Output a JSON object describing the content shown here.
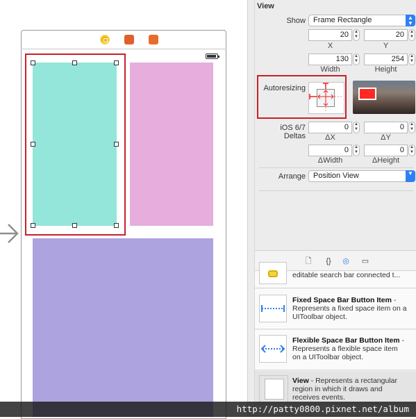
{
  "canvas": {
    "dock_icons": [
      "view-controller-icon",
      "first-responder-icon",
      "exit-icon"
    ],
    "colors": {
      "green_view": "#93e6d9",
      "pink_view": "#e6addd",
      "purple_view": "#ada3df",
      "selection": "#c8202a"
    }
  },
  "inspector": {
    "section_title": "View",
    "show_label": "Show",
    "show_value": "Frame Rectangle",
    "frame": {
      "x": "20",
      "y": "20",
      "width": "130",
      "height": "254",
      "x_label": "X",
      "y_label": "Y",
      "width_label": "Width",
      "height_label": "Height"
    },
    "autoresizing_label": "Autoresizing",
    "deltas_label": "iOS 6/7 Deltas",
    "deltas": {
      "dx": "0",
      "dy": "0",
      "dwidth": "0",
      "dheight": "0",
      "dx_label": "ΔX",
      "dy_label": "ΔY",
      "dwidth_label": "ΔWidth",
      "dheight_label": "ΔHeight"
    },
    "arrange_label": "Arrange",
    "arrange_value": "Position View"
  },
  "library": {
    "tabs": [
      "file-template-icon",
      "code-snippet-icon",
      "object-library-icon",
      "media-library-icon"
    ],
    "tab_glyphs": [
      "🗋",
      "{}",
      "◎",
      "▭"
    ],
    "items": [
      {
        "title": "",
        "desc": "editable search bar connected t..."
      },
      {
        "title": "Fixed Space Bar Button Item",
        "desc": " - Represents a fixed space item on a UIToolbar object."
      },
      {
        "title": "Flexible Space Bar Button Item",
        "desc": " - Represents a flexible space item on a UIToolbar object."
      },
      {
        "title": "View",
        "desc": " - Represents a rectangular region in which it draws and receives events."
      }
    ]
  },
  "watermark": "http://patty0800.pixnet.net/album"
}
